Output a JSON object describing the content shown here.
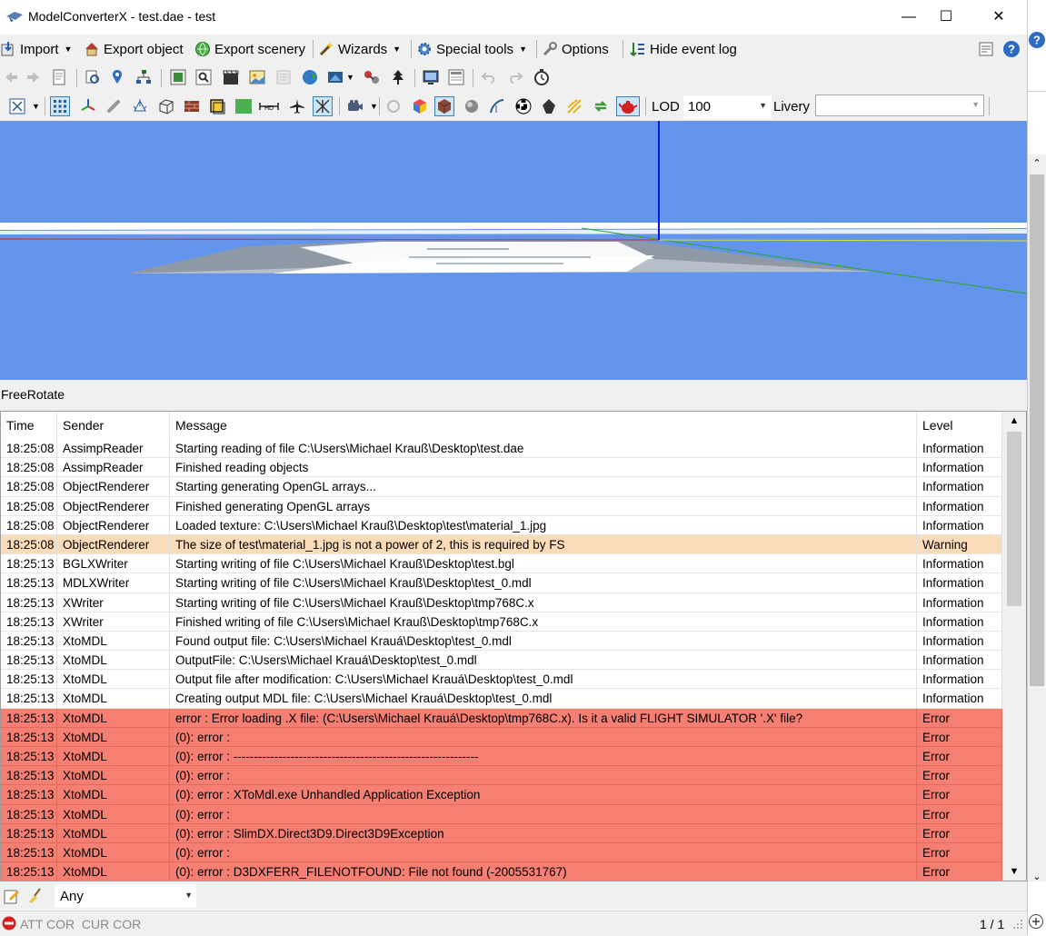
{
  "window": {
    "title": "ModelConverterX - test.dae - test",
    "controls": {
      "minimize": "—",
      "maximize": "☐",
      "close": "✕"
    }
  },
  "toolbar_main": {
    "import": "Import",
    "export_object": "Export object",
    "export_scenery": "Export scenery",
    "wizards": "Wizards",
    "special_tools": "Special tools",
    "options": "Options",
    "hide_event_log": "Hide event log"
  },
  "toolbar_view": {
    "lod_label": "LOD",
    "lod_value": "100",
    "livery_label": "Livery",
    "livery_value": ""
  },
  "viewport": {
    "mode_label": "FreeRotate",
    "background_color": "#6495ed"
  },
  "event_log": {
    "columns": [
      "Time",
      "Sender",
      "Message",
      "Level"
    ],
    "rows": [
      {
        "time": "18:25:08",
        "sender": "AssimpReader",
        "message": "Starting reading of file C:\\Users\\Michael Krauß\\Desktop\\test.dae",
        "level": "Information",
        "type": "info"
      },
      {
        "time": "18:25:08",
        "sender": "AssimpReader",
        "message": "Finished reading objects",
        "level": "Information",
        "type": "info"
      },
      {
        "time": "18:25:08",
        "sender": "ObjectRenderer",
        "message": "Starting generating OpenGL arrays...",
        "level": "Information",
        "type": "info"
      },
      {
        "time": "18:25:08",
        "sender": "ObjectRenderer",
        "message": "Finished generating OpenGL arrays",
        "level": "Information",
        "type": "info"
      },
      {
        "time": "18:25:08",
        "sender": "ObjectRenderer",
        "message": "Loaded texture: C:\\Users\\Michael Krauß\\Desktop\\test\\material_1.jpg",
        "level": "Information",
        "type": "info"
      },
      {
        "time": "18:25:08",
        "sender": "ObjectRenderer",
        "message": "The size of test\\material_1.jpg is not a power of 2, this is required by FS",
        "level": "Warning",
        "type": "warn"
      },
      {
        "time": "18:25:13",
        "sender": "BGLXWriter",
        "message": "Starting writing of file C:\\Users\\Michael Krauß\\Desktop\\test.bgl",
        "level": "Information",
        "type": "info"
      },
      {
        "time": "18:25:13",
        "sender": "MDLXWriter",
        "message": "Starting writing of file C:\\Users\\Michael Krauß\\Desktop\\test_0.mdl",
        "level": "Information",
        "type": "info"
      },
      {
        "time": "18:25:13",
        "sender": "XWriter",
        "message": "Starting writing of file C:\\Users\\Michael Krauß\\Desktop\\tmp768C.x",
        "level": "Information",
        "type": "info"
      },
      {
        "time": "18:25:13",
        "sender": "XWriter",
        "message": "Finished writing of file C:\\Users\\Michael Krauß\\Desktop\\tmp768C.x",
        "level": "Information",
        "type": "info"
      },
      {
        "time": "18:25:13",
        "sender": "XtoMDL",
        "message": "Found output file: C:\\Users\\Michael Krauá\\Desktop\\test_0.mdl",
        "level": "Information",
        "type": "info"
      },
      {
        "time": "18:25:13",
        "sender": "XtoMDL",
        "message": "OutputFile: C:\\Users\\Michael Krauá\\Desktop\\test_0.mdl",
        "level": "Information",
        "type": "info"
      },
      {
        "time": "18:25:13",
        "sender": "XtoMDL",
        "message": "Output file after modification: C:\\Users\\Michael Krauá\\Desktop\\test_0.mdl",
        "level": "Information",
        "type": "info"
      },
      {
        "time": "18:25:13",
        "sender": "XtoMDL",
        "message": "Creating output MDL file: C:\\Users\\Michael Krauá\\Desktop\\test_0.mdl",
        "level": "Information",
        "type": "info"
      },
      {
        "time": "18:25:13",
        "sender": "XtoMDL",
        "message": "error : Error loading .X file: (C:\\Users\\Michael Krauá\\Desktop\\tmp768C.x).  Is it a valid FLIGHT SIMULATOR '.X' file?",
        "level": "Error",
        "type": "err"
      },
      {
        "time": "18:25:13",
        "sender": "XtoMDL",
        "message": "(0): error :",
        "level": "Error",
        "type": "err"
      },
      {
        "time": "18:25:13",
        "sender": "XtoMDL",
        "message": "(0): error : ------------------------------------------------------------",
        "level": "Error",
        "type": "err"
      },
      {
        "time": "18:25:13",
        "sender": "XtoMDL",
        "message": "(0): error :",
        "level": "Error",
        "type": "err"
      },
      {
        "time": "18:25:13",
        "sender": "XtoMDL",
        "message": "(0): error : XToMdl.exe Unhandled Application Exception",
        "level": "Error",
        "type": "err"
      },
      {
        "time": "18:25:13",
        "sender": "XtoMDL",
        "message": "(0): error :",
        "level": "Error",
        "type": "err"
      },
      {
        "time": "18:25:13",
        "sender": "XtoMDL",
        "message": "(0): error : SlimDX.Direct3D9.Direct3D9Exception",
        "level": "Error",
        "type": "err"
      },
      {
        "time": "18:25:13",
        "sender": "XtoMDL",
        "message": "(0): error :",
        "level": "Error",
        "type": "err"
      },
      {
        "time": "18:25:13",
        "sender": "XtoMDL",
        "message": "(0): error : D3DXFERR_FILENOTFOUND: File not found (-2005531767)",
        "level": "Error",
        "type": "err"
      }
    ]
  },
  "filter": {
    "value": "Any"
  },
  "statusbar": {
    "left_text": "ATT COR  CUR COR",
    "page": "1 / 1"
  },
  "colors": {
    "warning_row": "#fcdcb8",
    "error_row": "#f47f72",
    "viewport": "#6495ed"
  }
}
